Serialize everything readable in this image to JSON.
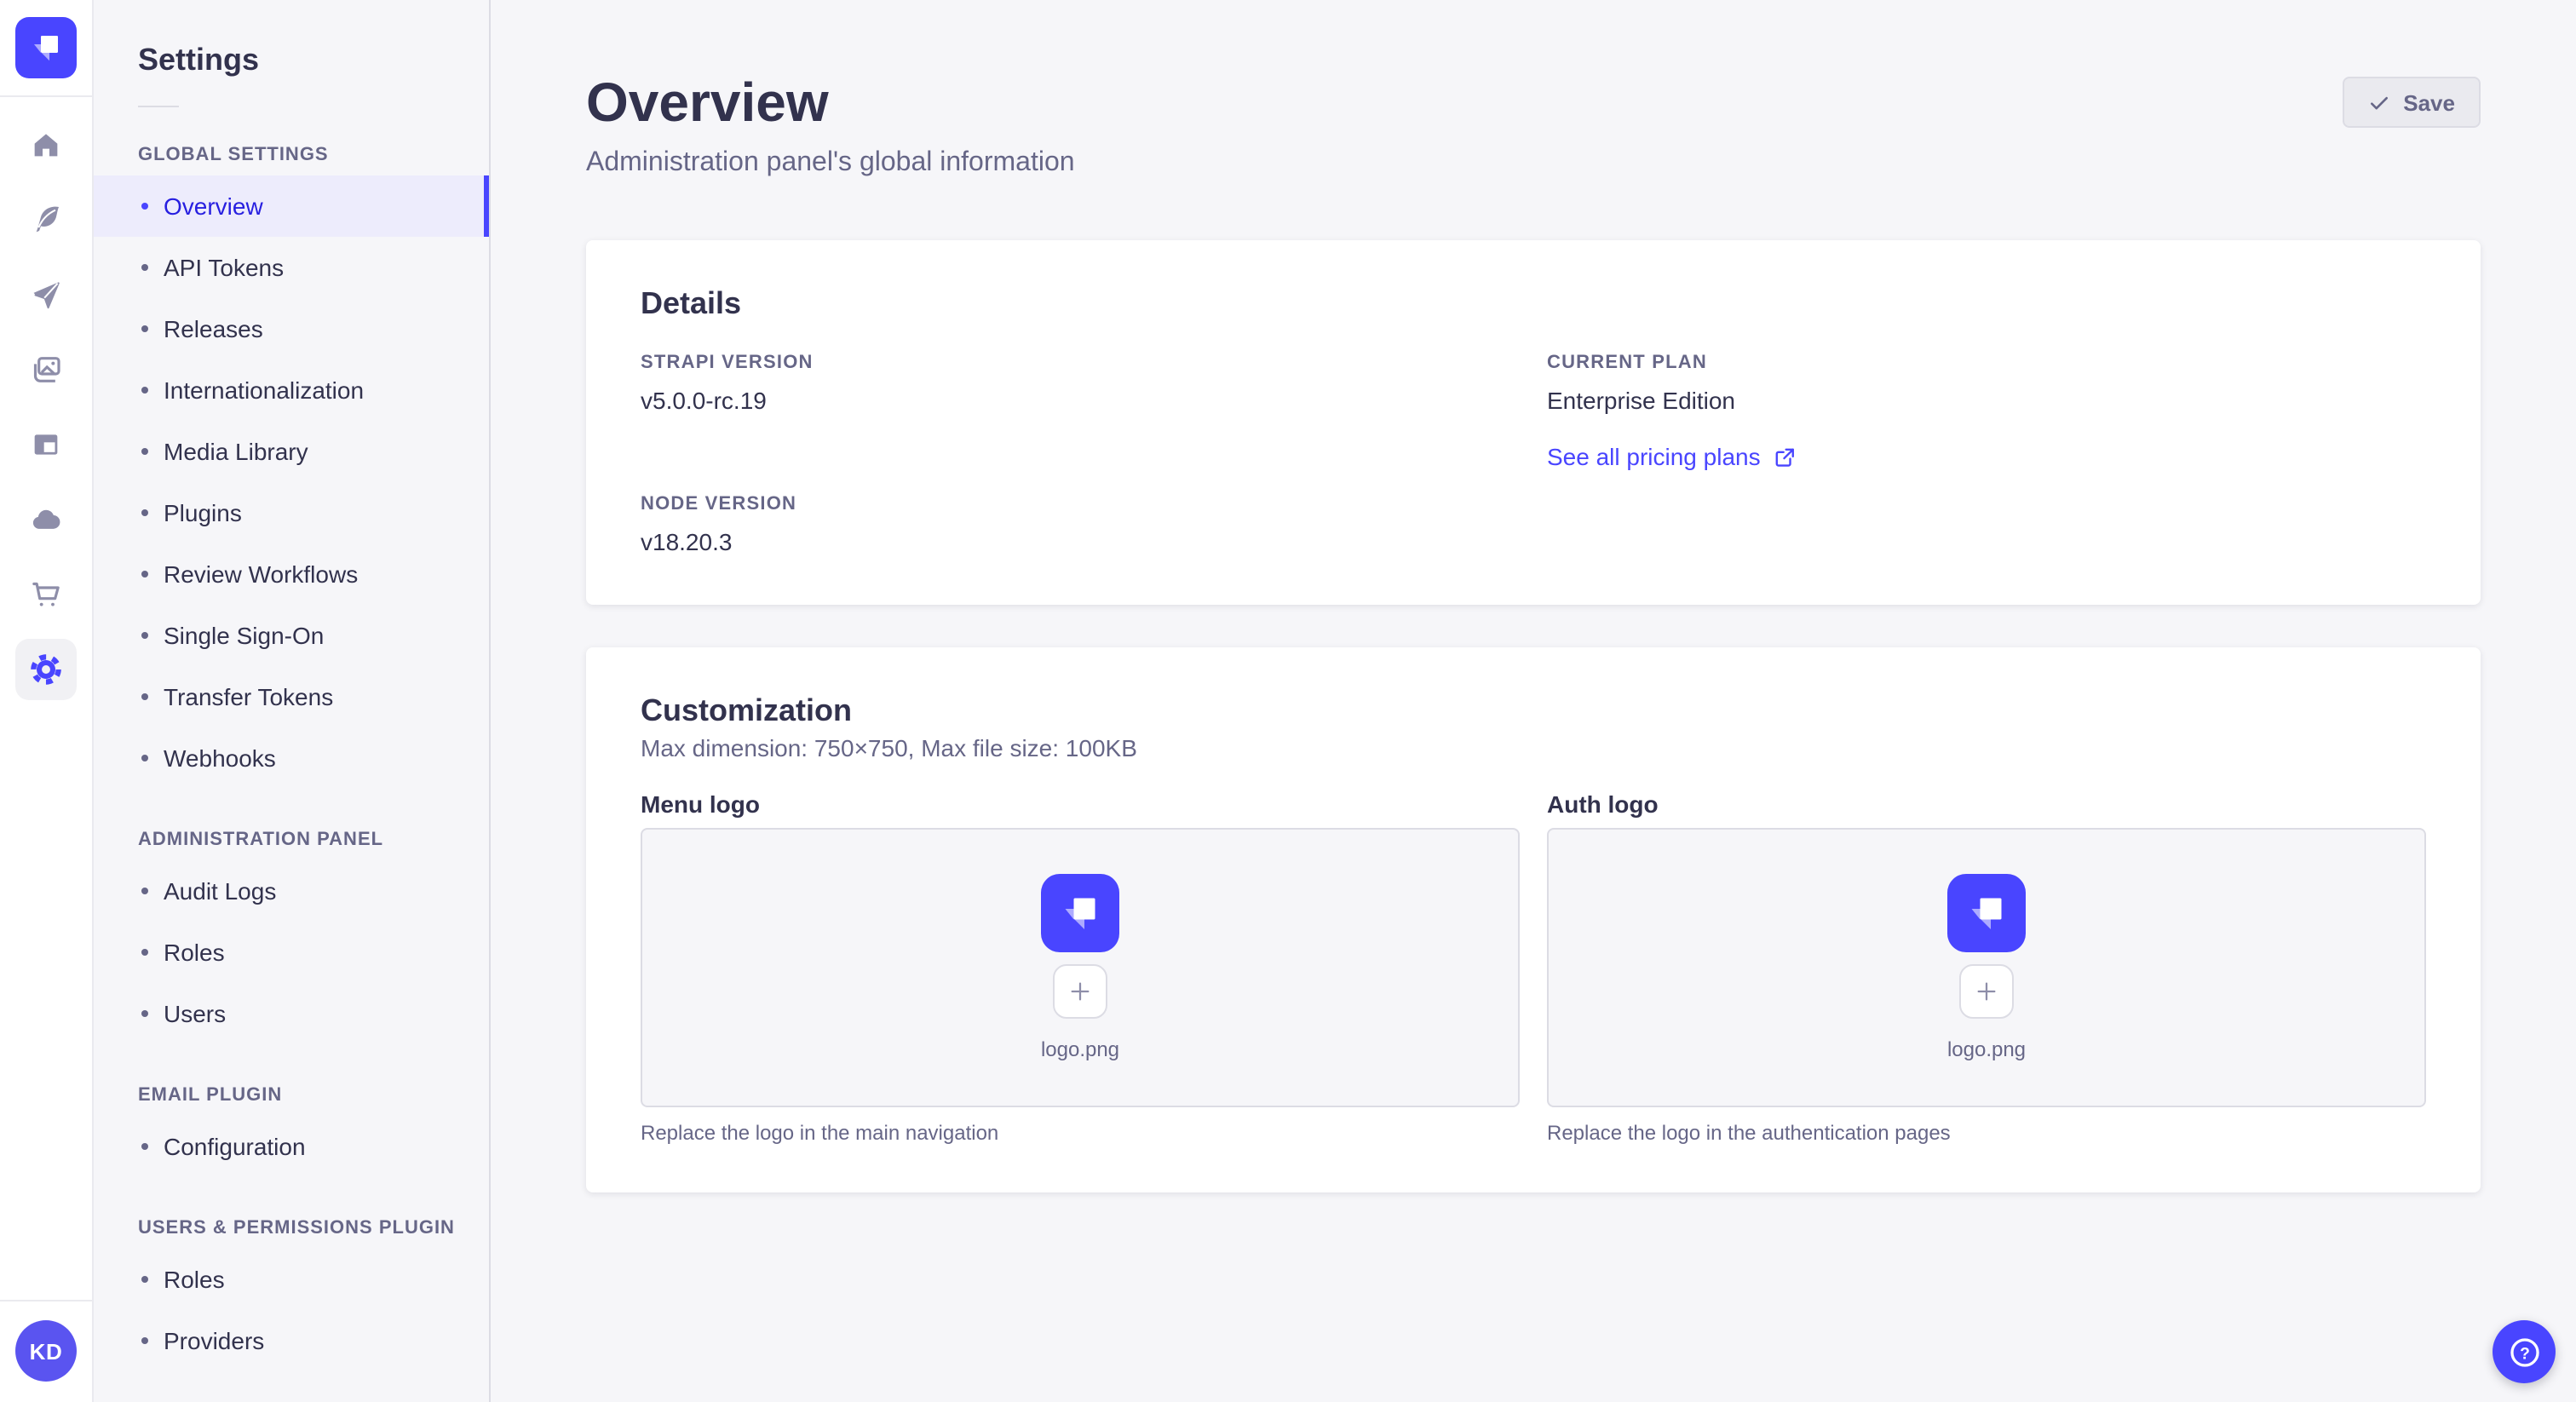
{
  "rail": {
    "logo_icon": "strapi-logo",
    "icons": [
      "home",
      "feather",
      "paper-plane",
      "images",
      "layout",
      "cloud",
      "cart",
      "gear"
    ],
    "active_icon": "gear",
    "avatar_initials": "KD"
  },
  "subnav": {
    "title": "Settings",
    "sections": [
      {
        "header": "GLOBAL SETTINGS",
        "items": [
          {
            "label": "Overview",
            "active": true
          },
          {
            "label": "API Tokens"
          },
          {
            "label": "Releases"
          },
          {
            "label": "Internationalization"
          },
          {
            "label": "Media Library"
          },
          {
            "label": "Plugins"
          },
          {
            "label": "Review Workflows"
          },
          {
            "label": "Single Sign-On"
          },
          {
            "label": "Transfer Tokens"
          },
          {
            "label": "Webhooks"
          }
        ]
      },
      {
        "header": "ADMINISTRATION PANEL",
        "items": [
          {
            "label": "Audit Logs"
          },
          {
            "label": "Roles"
          },
          {
            "label": "Users"
          }
        ]
      },
      {
        "header": "EMAIL PLUGIN",
        "items": [
          {
            "label": "Configuration"
          }
        ]
      },
      {
        "header": "USERS & PERMISSIONS PLUGIN",
        "items": [
          {
            "label": "Roles"
          },
          {
            "label": "Providers"
          }
        ]
      }
    ]
  },
  "page": {
    "title": "Overview",
    "subtitle": "Administration panel's global information",
    "save_label": "Save"
  },
  "details": {
    "heading": "Details",
    "strapi_version_label": "STRAPI VERSION",
    "strapi_version": "v5.0.0-rc.19",
    "node_version_label": "NODE VERSION",
    "node_version": "v18.20.3",
    "current_plan_label": "CURRENT PLAN",
    "current_plan": "Enterprise Edition",
    "pricing_link_label": "See all pricing plans",
    "pricing_link_icon": "external-link-icon"
  },
  "customization": {
    "heading": "Customization",
    "subtitle": "Max dimension: 750×750, Max file size: 100KB",
    "menu_logo_label": "Menu logo",
    "auth_logo_label": "Auth logo",
    "file_name": "logo.png",
    "menu_hint": "Replace the logo in the main navigation",
    "auth_hint": "Replace the logo in the authentication pages"
  },
  "help": {
    "icon": "question-mark"
  },
  "colors": {
    "primary": "#4945ff",
    "active_nav_text": "#271fe0",
    "active_nav_bg": "#edecfc",
    "text": "#32324d",
    "muted": "#666687",
    "icon_gray": "#8e8ea9",
    "page_bg": "#f6f6f9",
    "card_bg": "#ffffff",
    "border": "#dcdce4"
  }
}
